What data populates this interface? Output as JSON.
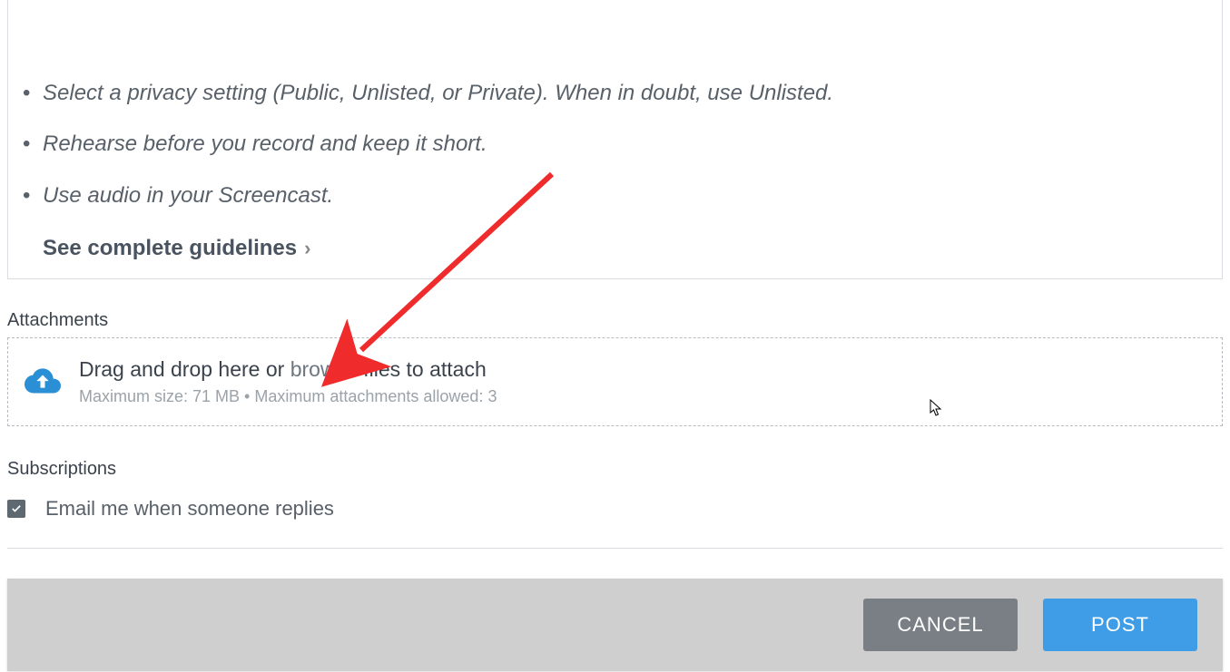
{
  "content": {
    "bullets": [
      "Select a privacy setting (Public, Unlisted, or Private). When in doubt, use Unlisted.",
      "Rehearse before you record and keep it short.",
      "Use audio in your Screencast."
    ],
    "guidelines_link": "See complete guidelines"
  },
  "attachments": {
    "label": "Attachments",
    "drop_prefix": "Drag and drop here or ",
    "browse": "browse",
    "drop_suffix": " files to attach",
    "limits": "Maximum size: 71 MB • Maximum attachments allowed: 3"
  },
  "subscriptions": {
    "label": "Subscriptions",
    "checkbox_label": "Email me when someone replies",
    "checked": true
  },
  "footer": {
    "cancel": "CANCEL",
    "post": "POST"
  }
}
